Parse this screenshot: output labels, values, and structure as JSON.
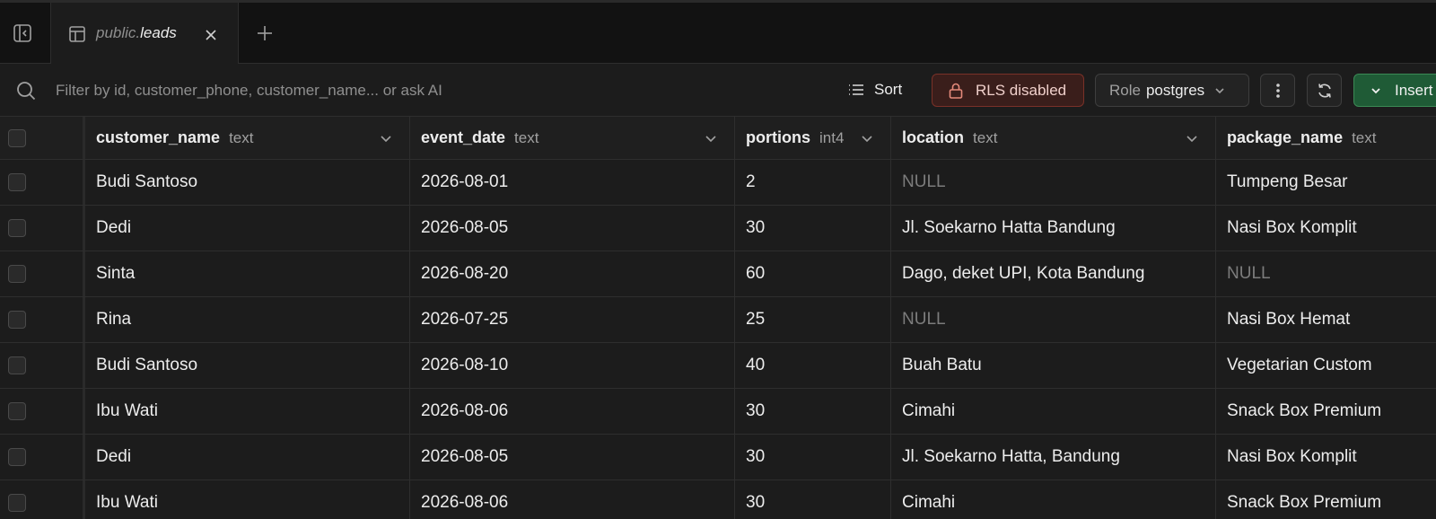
{
  "tab": {
    "schema": "public.",
    "table": "leads"
  },
  "icons": {
    "sidebar_toggle": "sidebar-panel-icon",
    "tab": "table-icon",
    "close": "close-icon",
    "new_tab": "plus-icon",
    "search": "search-icon",
    "sort": "list-icon",
    "rls": "lock-icon",
    "more": "vertical-dots-icon",
    "refresh": "refresh-icon",
    "chevron": "chevron-down-icon"
  },
  "toolbar": {
    "search_placeholder": "Filter by id, customer_phone, customer_name... or ask AI",
    "sort_label": "Sort",
    "rls_label": "RLS disabled",
    "role_label": "Role",
    "role_value": "postgres",
    "insert_label": "Insert"
  },
  "colors": {
    "background": "#1c1c1c",
    "rls_bg": "#3a1e1b",
    "rls_border": "#7a3128",
    "insert_bg": "#1f5b36",
    "insert_border": "#3b8a55",
    "null_text": "#7c7c7c"
  },
  "table": {
    "columns": [
      {
        "name": "customer_name",
        "type": "text"
      },
      {
        "name": "event_date",
        "type": "text"
      },
      {
        "name": "portions",
        "type": "int4"
      },
      {
        "name": "location",
        "type": "text"
      },
      {
        "name": "package_name",
        "type": "text"
      }
    ],
    "rows": [
      [
        "Budi Santoso",
        "2026-08-01",
        "2",
        "NULL",
        "Tumpeng Besar"
      ],
      [
        "Dedi",
        "2026-08-05",
        "30",
        "Jl. Soekarno Hatta Bandung",
        "Nasi Box Komplit"
      ],
      [
        "Sinta",
        "2026-08-20",
        "60",
        "Dago, deket UPI, Kota Bandung",
        "NULL"
      ],
      [
        "Rina",
        "2026-07-25",
        "25",
        "NULL",
        "Nasi Box Hemat"
      ],
      [
        "Budi Santoso",
        "2026-08-10",
        "40",
        "Buah Batu",
        "Vegetarian Custom"
      ],
      [
        "Ibu Wati",
        "2026-08-06",
        "30",
        "Cimahi",
        "Snack Box Premium"
      ],
      [
        "Dedi",
        "2026-08-05",
        "30",
        "Jl. Soekarno Hatta, Bandung",
        "Nasi Box Komplit"
      ],
      [
        "Ibu Wati",
        "2026-08-06",
        "30",
        "Cimahi",
        "Snack Box Premium"
      ]
    ]
  }
}
